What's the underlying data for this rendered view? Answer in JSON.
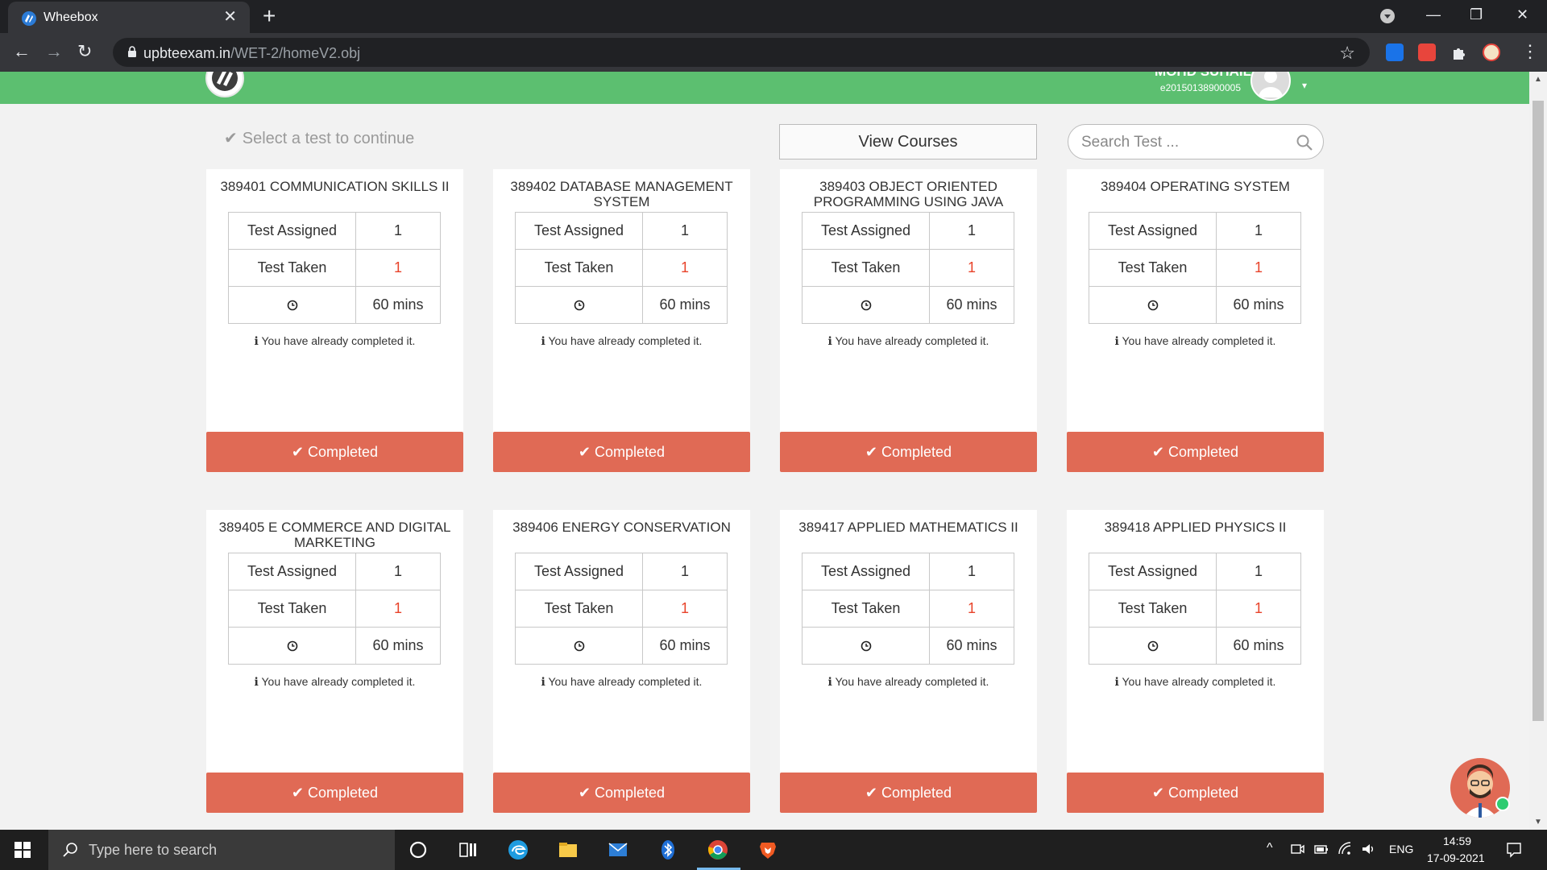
{
  "browser": {
    "tab_title": "Wheebox",
    "tab_close": "✕",
    "new_tab": "+",
    "url_host": "upbteexam.in",
    "url_path": "/WET-2/homeV2.obj",
    "window_controls": {
      "minimize": "—",
      "restore": "❐",
      "close": "✕"
    },
    "nav": {
      "back": "←",
      "forward": "→",
      "reload": "↻"
    },
    "star": "☆"
  },
  "header": {
    "user_name": "MOHD SUHAIL",
    "user_id": "e20150138900005",
    "caret": "▾"
  },
  "toolbar": {
    "select_hint": "Select a test to continue",
    "check_glyph": "✔",
    "view_courses_label": "View Courses",
    "search_placeholder": "Search Test ..."
  },
  "test_cards": [
    {
      "title": "389401 COMMUNICATION SKILLS II",
      "assigned_label": "Test Assigned",
      "assigned_value": "1",
      "taken_label": "Test Taken",
      "taken_value": "1",
      "duration": "60 mins",
      "note": "ℹ You have already completed it.",
      "status": "✔ Completed"
    },
    {
      "title": "389402 DATABASE MANAGEMENT SYSTEM",
      "assigned_label": "Test Assigned",
      "assigned_value": "1",
      "taken_label": "Test Taken",
      "taken_value": "1",
      "duration": "60 mins",
      "note": "ℹ You have already completed it.",
      "status": "✔ Completed"
    },
    {
      "title": "389403 OBJECT ORIENTED PROGRAMMING USING JAVA",
      "assigned_label": "Test Assigned",
      "assigned_value": "1",
      "taken_label": "Test Taken",
      "taken_value": "1",
      "duration": "60 mins",
      "note": "ℹ You have already completed it.",
      "status": "✔ Completed"
    },
    {
      "title": "389404 OPERATING SYSTEM",
      "assigned_label": "Test Assigned",
      "assigned_value": "1",
      "taken_label": "Test Taken",
      "taken_value": "1",
      "duration": "60 mins",
      "note": "ℹ You have already completed it.",
      "status": "✔ Completed"
    },
    {
      "title": "389405 E COMMERCE AND DIGITAL MARKETING",
      "assigned_label": "Test Assigned",
      "assigned_value": "1",
      "taken_label": "Test Taken",
      "taken_value": "1",
      "duration": "60 mins",
      "note": "ℹ You have already completed it.",
      "status": "✔ Completed"
    },
    {
      "title": "389406 ENERGY CONSERVATION",
      "assigned_label": "Test Assigned",
      "assigned_value": "1",
      "taken_label": "Test Taken",
      "taken_value": "1",
      "duration": "60 mins",
      "note": "ℹ You have already completed it.",
      "status": "✔ Completed"
    },
    {
      "title": "389417 APPLIED MATHEMATICS II",
      "assigned_label": "Test Assigned",
      "assigned_value": "1",
      "taken_label": "Test Taken",
      "taken_value": "1",
      "duration": "60 mins",
      "note": "ℹ You have already completed it.",
      "status": "✔ Completed"
    },
    {
      "title": "389418 APPLIED PHYSICS II",
      "assigned_label": "Test Assigned",
      "assigned_value": "1",
      "taken_label": "Test Taken",
      "taken_value": "1",
      "duration": "60 mins",
      "note": "ℹ You have already completed it.",
      "status": "✔ Completed"
    }
  ],
  "taskbar": {
    "search_placeholder": "Type here to search",
    "language": "ENG",
    "time": "14:59",
    "date": "17-09-2021",
    "tray_caret": "^"
  },
  "colors": {
    "header_green": "#5cbf70",
    "completed_red": "#e06a55",
    "taken_value_red": "#e8432a"
  },
  "icons": [
    "wheebox-favicon",
    "lock-icon",
    "star-icon",
    "extension-icon",
    "clock-icon",
    "search-icon",
    "check-icon",
    "info-icon",
    "windows-start-icon",
    "chat-bot-icon"
  ]
}
